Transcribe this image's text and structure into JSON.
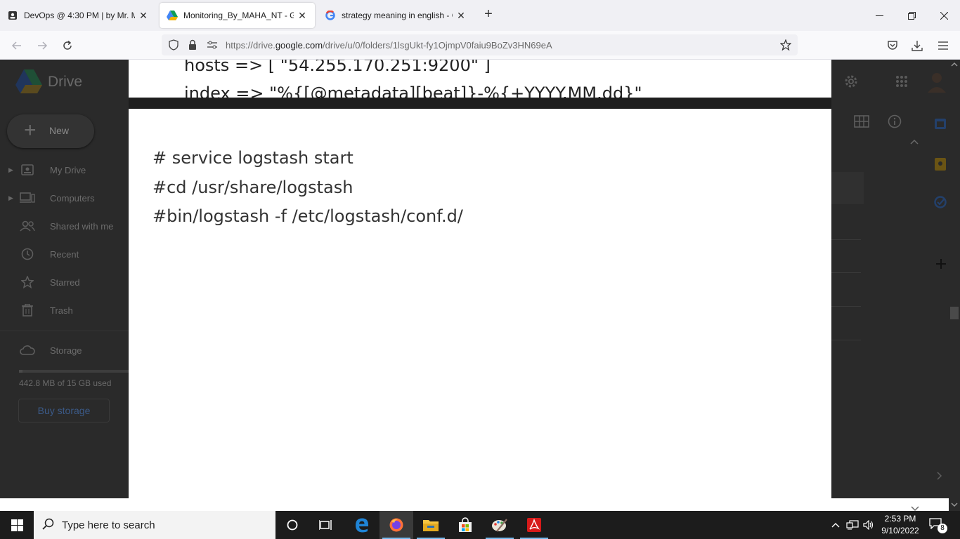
{
  "browser": {
    "tabs": [
      {
        "title": "DevOps @ 4:30 PM | by Mr. Mah",
        "icon": "contact-icon",
        "active": false
      },
      {
        "title": "Monitoring_By_MAHA_NT - Go",
        "icon": "drive-icon",
        "active": true
      },
      {
        "title": "strategy meaning in english - G",
        "icon": "google-icon",
        "active": false
      }
    ],
    "new_tab_symbol": "+",
    "url_prefix": "https://drive.",
    "url_domain": "google.com",
    "url_suffix": "/drive/u/0/folders/1lsgUkt-fy1OjmpV0faiu9BoZv3HN69eA"
  },
  "drive": {
    "app_name": "Drive",
    "new_label": "New",
    "nav": [
      {
        "label": "My Drive",
        "icon": "my-drive-icon",
        "expandable": true
      },
      {
        "label": "Computers",
        "icon": "computers-icon",
        "expandable": true
      },
      {
        "label": "Shared with me",
        "icon": "shared-icon",
        "expandable": false
      },
      {
        "label": "Recent",
        "icon": "clock-icon",
        "expandable": false
      },
      {
        "label": "Starred",
        "icon": "star-icon",
        "expandable": false
      },
      {
        "label": "Trash",
        "icon": "trash-icon",
        "expandable": false
      }
    ],
    "storage_label": "Storage",
    "storage_used": "442.8 MB of 15 GB used",
    "storage_fraction": 0.029,
    "buy_storage": "Buy storage"
  },
  "viewer": {
    "prev_slide_lines": [
      "hosts => [ \"54.255.170.251:9200\" ]",
      "index => \"%{[@metadata][beat]}-%{+YYYY.MM.dd}\""
    ],
    "slide_lines": [
      "# service logstash start",
      "#cd /usr/share/logstash",
      "#bin/logstash -f /etc/logstash/conf.d/"
    ]
  },
  "taskbar": {
    "search_placeholder": "Type here to search",
    "time": "2:53 PM",
    "date": "9/10/2022",
    "notification_count": "8"
  },
  "colors": {
    "accent": "#76b9ed",
    "overlay": "#2a2a2a",
    "tab_bar": "#f0f0f4"
  }
}
